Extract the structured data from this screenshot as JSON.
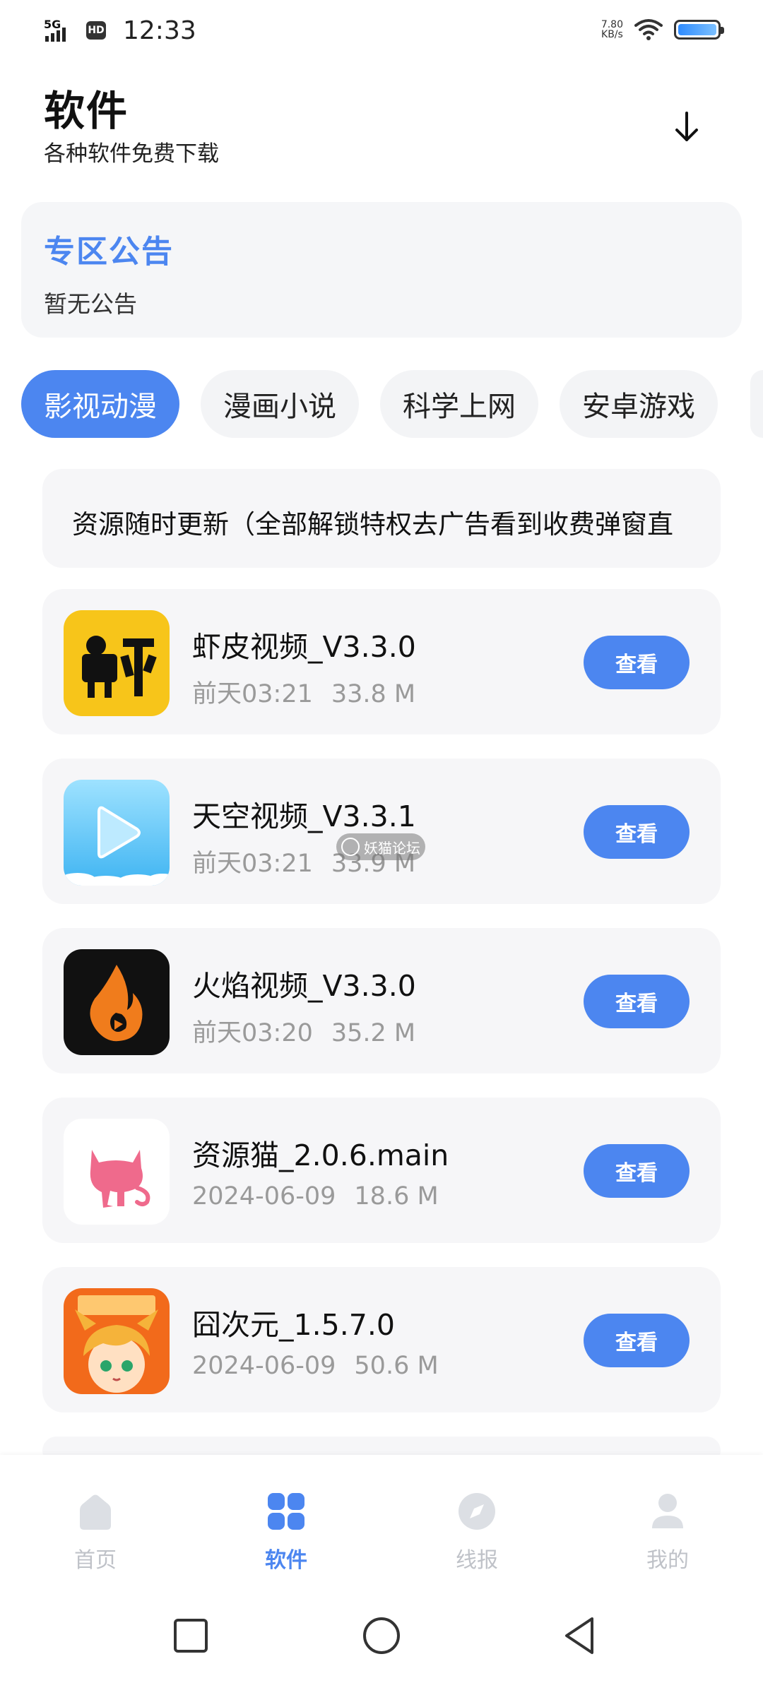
{
  "status_bar": {
    "network": "5G",
    "hd": "HD",
    "time": "12:33",
    "speed_value": "7.80",
    "speed_unit": "KB/s"
  },
  "header": {
    "title": "软件",
    "subtitle": "各种软件免费下载",
    "download_icon": "arrow-down-icon"
  },
  "notice": {
    "title": "专区公告",
    "text": "暂无公告"
  },
  "tabs": [
    {
      "label": "影视动漫",
      "active": true
    },
    {
      "label": "漫画小说",
      "active": false
    },
    {
      "label": "科学上网",
      "active": false
    },
    {
      "label": "安卓游戏",
      "active": false
    }
  ],
  "marquee_text": "资源随时更新（全部解锁特权去广告看到收费弹窗直",
  "apps": [
    {
      "name": "虾皮视频_V3.3.0",
      "date": "前天03:21",
      "size": "33.8 M",
      "button": "查看"
    },
    {
      "name": "天空视频_V3.3.1",
      "date": "前天03:21",
      "size": "33.9 M",
      "button": "查看"
    },
    {
      "name": "火焰视频_V3.3.0",
      "date": "前天03:20",
      "size": "35.2 M",
      "button": "查看"
    },
    {
      "name": "资源猫_2.0.6.main",
      "date": "2024-06-09",
      "size": "18.6 M",
      "button": "查看"
    },
    {
      "name": "囧次元_1.5.7.0",
      "date": "2024-06-09",
      "size": "50.6 M",
      "button": "查看"
    }
  ],
  "watermark": "妖猫论坛",
  "bottom_nav": [
    {
      "label": "首页",
      "icon": "home-icon",
      "active": false
    },
    {
      "label": "软件",
      "icon": "grid-icon",
      "active": true
    },
    {
      "label": "线报",
      "icon": "compass-icon",
      "active": false
    },
    {
      "label": "我的",
      "icon": "person-icon",
      "active": false
    }
  ],
  "colors": {
    "accent": "#4c86f0",
    "card_bg": "#f6f6f8",
    "muted_text": "#9a9a9a"
  }
}
